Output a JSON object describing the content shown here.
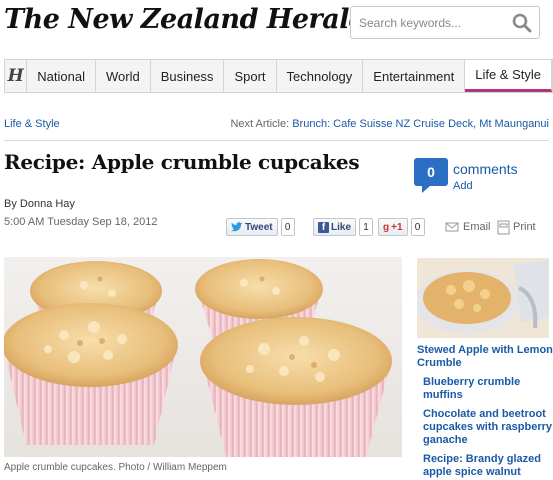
{
  "masthead": {
    "logo": "The New Zealand Herald",
    "search_placeholder": "Search keywords..."
  },
  "nav": {
    "home_icon": "H",
    "items": [
      {
        "label": "National",
        "active": false
      },
      {
        "label": "World",
        "active": false
      },
      {
        "label": "Business",
        "active": false
      },
      {
        "label": "Sport",
        "active": false
      },
      {
        "label": "Technology",
        "active": false
      },
      {
        "label": "Entertainment",
        "active": false
      },
      {
        "label": "Life & Style",
        "active": true
      }
    ]
  },
  "section": {
    "label": "Life & Style",
    "next_prefix": "Next Article:",
    "next_link": "Brunch: Cafe Suisse NZ Cruise Deck, Mt Maunganui"
  },
  "article": {
    "headline": "Recipe: Apple crumble cupcakes",
    "byline": "By Donna Hay",
    "dateline": "5:00 AM Tuesday Sep 18, 2012",
    "caption": "Apple crumble cupcakes. Photo / William Meppem"
  },
  "comments": {
    "count": "0",
    "label": "comments",
    "add": "Add"
  },
  "share": {
    "tweet_label": "Tweet",
    "tweet_count": "0",
    "like_label": "Like",
    "like_count": "1",
    "plusone_label": "+1",
    "plusone_count": "0",
    "email_label": "Email",
    "print_label": "Print"
  },
  "sidebar": {
    "feature": "Stewed Apple with Lemon Crumble",
    "links": [
      "Blueberry crumble muffins",
      "Chocolate and beetroot cupcakes with raspberry ganache",
      "Recipe: Brandy glazed apple spice walnut"
    ]
  },
  "colors": {
    "link_blue": "#1a5aa6",
    "nav_active_underline": "#b0357a",
    "comment_bubble": "#2b6fc4"
  }
}
